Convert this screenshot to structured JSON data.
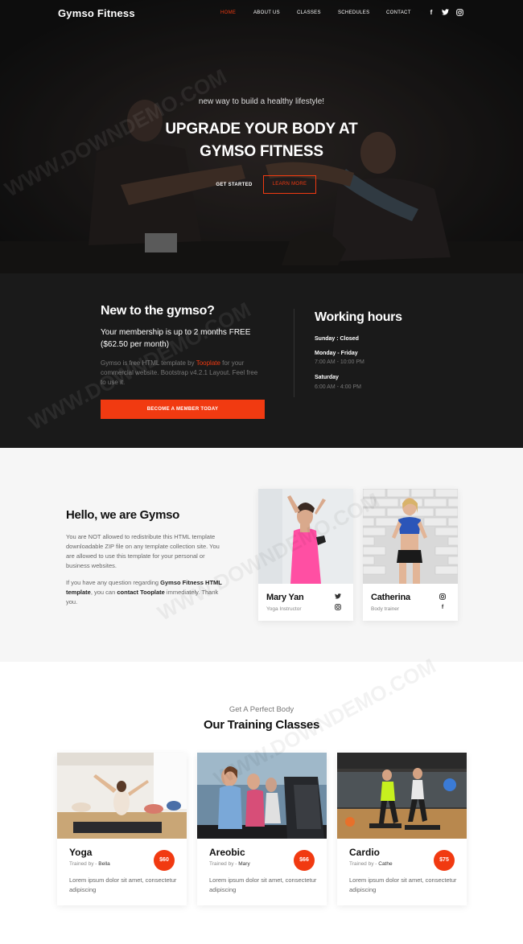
{
  "nav": {
    "brand": "Gymso Fitness",
    "items": [
      {
        "label": "HOME",
        "active": true
      },
      {
        "label": "ABOUT US",
        "active": false
      },
      {
        "label": "CLASSES",
        "active": false
      },
      {
        "label": "SCHEDULES",
        "active": false
      },
      {
        "label": "CONTACT",
        "active": false
      }
    ],
    "social": [
      {
        "icon": "facebook-icon",
        "glyph": "f"
      },
      {
        "icon": "twitter-icon",
        "glyph": "t"
      },
      {
        "icon": "instagram-icon",
        "glyph": "◎"
      }
    ]
  },
  "hero": {
    "subtitle": "new way to build a healthy lifestyle!",
    "title_line1": "UPGRADE YOUR BODY AT",
    "title_line2": "GYMSO FITNESS",
    "get_started": "GET STARTED",
    "learn_more": "LEARN MORE"
  },
  "membership": {
    "heading": "New to the gymso?",
    "offer_line1": "Your membership is up to 2 months FREE",
    "offer_line2": "($62.50 per month)",
    "desc_part1": "Gymso is free HTML template by ",
    "desc_link": "Tooplate",
    "desc_part2": " for your commercial website. Bootstrap v4.2.1 Layout. Feel free to use it.",
    "button": "BECOME A MEMBER TODAY"
  },
  "hours": {
    "heading": "Working hours",
    "rows": [
      {
        "day": "Sunday : Closed",
        "time": ""
      },
      {
        "day": "Monday - Friday",
        "time": "7:00 AM - 10:00 PM"
      },
      {
        "day": "Saturday",
        "time": "6:00 AM - 4:00 PM"
      }
    ]
  },
  "about": {
    "heading": "Hello, we are Gymso",
    "p1": "You are NOT allowed to redistribute this HTML template downloadable ZIP file on any template collection site. You are allowed to use this template for your personal or business websites.",
    "p2_part1": "If you have any question regarding ",
    "p2_bold1": "Gymso Fitness HTML template",
    "p2_part2": ", you can ",
    "p2_bold2": "contact Tooplate",
    "p2_part3": " immediately. Thank you."
  },
  "trainers": [
    {
      "name": "Mary Yan",
      "role": "Yoga Instructor",
      "icons": [
        "twitter-icon",
        "instagram-icon"
      ]
    },
    {
      "name": "Catherina",
      "role": "Body trainer",
      "icons": [
        "instagram-icon",
        "facebook-icon"
      ]
    }
  ],
  "classes": {
    "kicker": "Get A Perfect Body",
    "heading": "Our Training Classes",
    "trainer_prefix": "Trained by - ",
    "desc": "Lorem ipsum dolor sit amet, consectetur adipiscing",
    "items": [
      {
        "name": "Yoga",
        "trainer": "Bella",
        "price": "$60"
      },
      {
        "name": "Areobic",
        "trainer": "Mary",
        "price": "$66"
      },
      {
        "name": "Cardio",
        "trainer": "Cathe",
        "price": "$75"
      }
    ]
  },
  "colors": {
    "accent": "#f13a11",
    "dark": "#1a1a1a",
    "light_section": "#f6f6f6"
  }
}
